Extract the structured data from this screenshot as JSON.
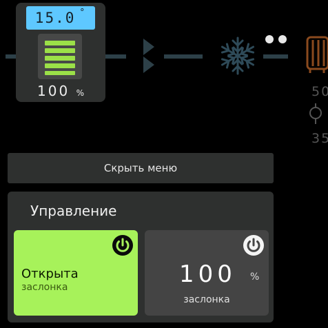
{
  "scheme": {
    "setpoint": "15.0",
    "setpoint_unit": "°",
    "damper_percent": "100",
    "damper_percent_unit": "%",
    "heater_value_top": "50",
    "heater_value_bottom": "35",
    "icons": [
      "damper-icon",
      "flow-arrow-icon",
      "snowflake-icon",
      "fan-dots-icon",
      "heater-icon",
      "gauge-icon"
    ]
  },
  "menu": {
    "hide_label": "Скрыть меню"
  },
  "control": {
    "title": "Управление",
    "open_tile": {
      "state": "Открыта",
      "subtitle": "заслонка"
    },
    "percent_tile": {
      "value": "100",
      "unit": "%",
      "subtitle": "заслонка"
    }
  },
  "colors": {
    "background": "#000000",
    "panel": "#2e302f",
    "accent_green": "#a7f25a",
    "damper_green": "#9be048",
    "setpoint_blue": "#5ec8ff",
    "duct": "#2d4048",
    "heater_orange": "#8a4a1e"
  }
}
